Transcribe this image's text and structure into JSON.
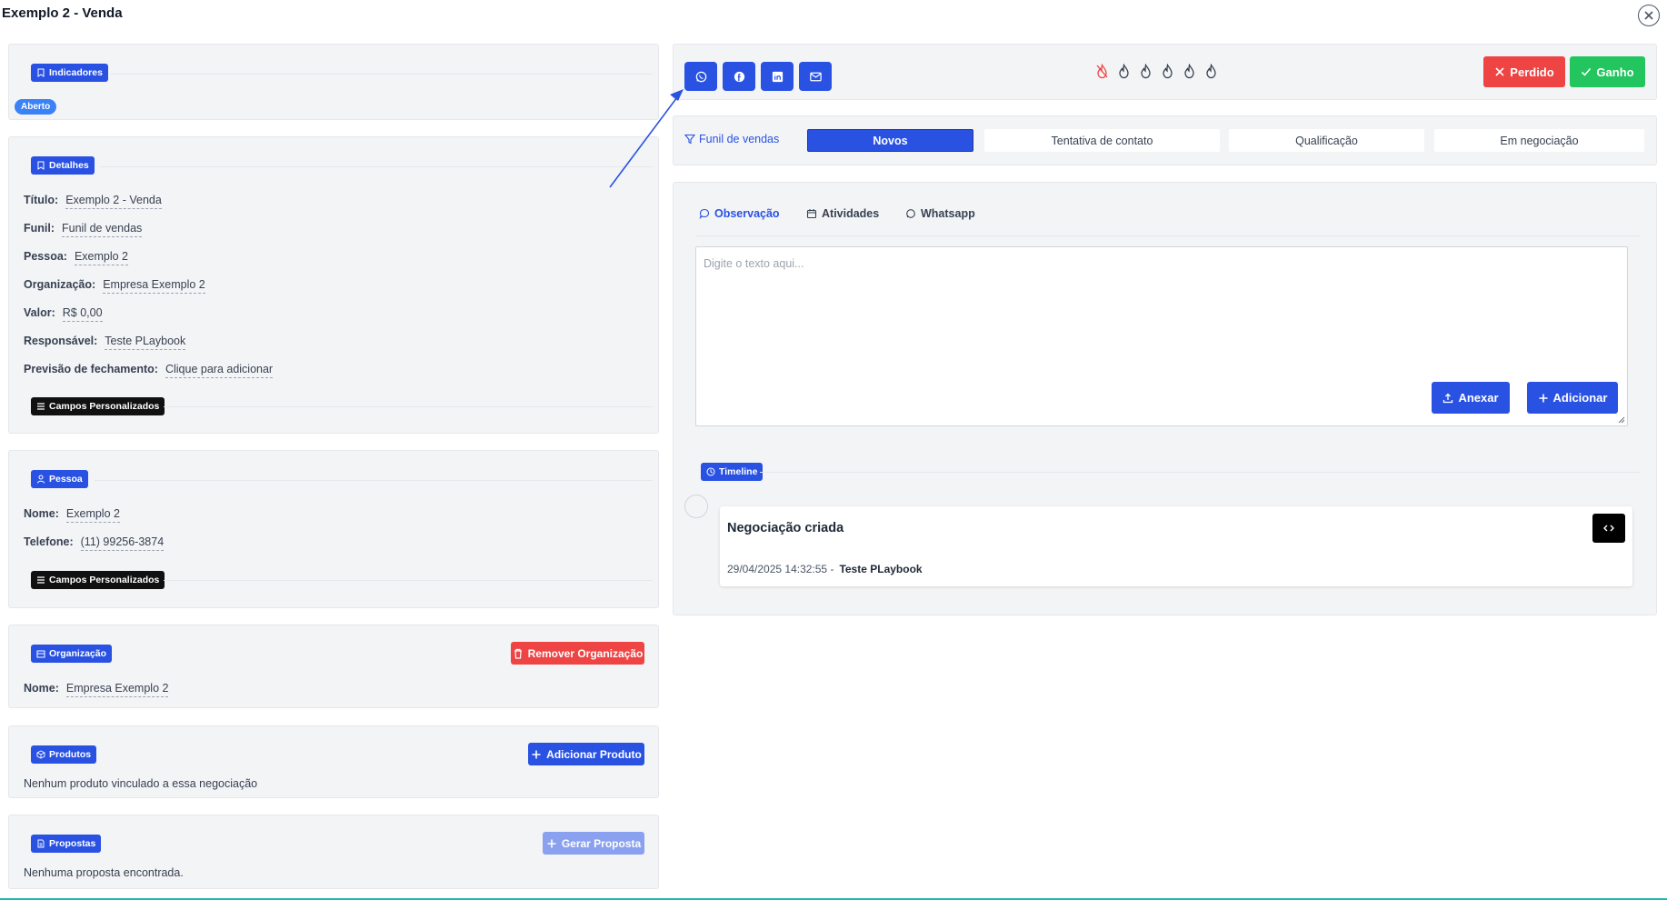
{
  "page": {
    "title": "Exemplo 2 - Venda"
  },
  "indicadores": {
    "badge": "Indicadores",
    "status": "Aberto"
  },
  "detalhes": {
    "badge": "Detalhes",
    "fields": [
      {
        "label": "Título:",
        "value": "Exemplo 2 - Venda"
      },
      {
        "label": "Funil:",
        "value": "Funil de vendas"
      },
      {
        "label": "Pessoa:",
        "value": "Exemplo 2"
      },
      {
        "label": "Organização:",
        "value": "Empresa Exemplo 2"
      },
      {
        "label": "Valor:",
        "value": "R$ 0,00"
      },
      {
        "label": "Responsável:",
        "value": "Teste PLaybook"
      },
      {
        "label": "Previsão de fechamento:",
        "value": "Clique para adicionar"
      }
    ],
    "custom_fields": "Campos Personalizados"
  },
  "pessoa": {
    "badge": "Pessoa",
    "fields": [
      {
        "label": "Nome:",
        "value": "Exemplo 2"
      },
      {
        "label": "Telefone:",
        "value": "(11) 99256-3874"
      }
    ],
    "custom_fields": "Campos Personalizados"
  },
  "organizacao": {
    "badge": "Organização",
    "remove_button": "Remover Organização",
    "fields": [
      {
        "label": "Nome:",
        "value": "Empresa Exemplo 2"
      }
    ]
  },
  "produtos": {
    "badge": "Produtos",
    "add_button": "Adicionar Produto",
    "empty": "Nenhum produto vinculado a essa negociação"
  },
  "propostas": {
    "badge": "Propostas",
    "generate_button": "Gerar Proposta",
    "empty": "Nenhuma proposta encontrada."
  },
  "actions": {
    "icons": [
      "whatsapp-icon",
      "facebook-icon",
      "linkedin-icon",
      "mail-icon"
    ],
    "lost": "Perdido",
    "won": "Ganho"
  },
  "pipeline": {
    "funnel_link": "Funil de vendas",
    "stages": [
      "Novos",
      "Tentativa de contato",
      "Qualificação",
      "Em negociação"
    ],
    "active_stage": "Novos"
  },
  "activity": {
    "tabs": [
      "Observação",
      "Atividades",
      "Whatsapp"
    ],
    "placeholder": "Digite o texto aqui...",
    "attach": "Anexar",
    "add": "Adicionar",
    "timeline_badge": "Timeline",
    "entries": [
      {
        "title": "Negociação criada",
        "timestamp": "29/04/2025 14:32:55 -",
        "author": "Teste PLaybook"
      }
    ]
  },
  "colors": {
    "primary": "#2952e3",
    "danger": "#ef4444",
    "success": "#22c55e"
  }
}
